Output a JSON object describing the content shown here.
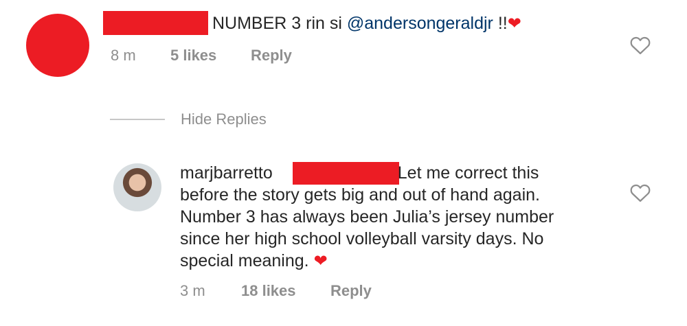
{
  "comment": {
    "text": "NUMBER 3 rin si",
    "mention": "@andersongeraldjr",
    "suffix": " !!",
    "time": "8 m",
    "likes": "5 likes",
    "reply": "Reply"
  },
  "thread": {
    "hide_replies": "Hide Replies"
  },
  "reply": {
    "username": "marjbarretto",
    "text_line1": "Let me correct this",
    "text_rest": "before the story gets big and out of hand again. Number 3 has always been Julia’s jersey number since her high school volleyball varsity days. No special meaning.",
    "time": "3 m",
    "likes": "18 likes",
    "reply": "Reply"
  },
  "colors": {
    "redaction": "#ec1c24",
    "mention": "#003569",
    "meta": "#8e8e8e",
    "heart_emoji": "#ed1c24"
  }
}
